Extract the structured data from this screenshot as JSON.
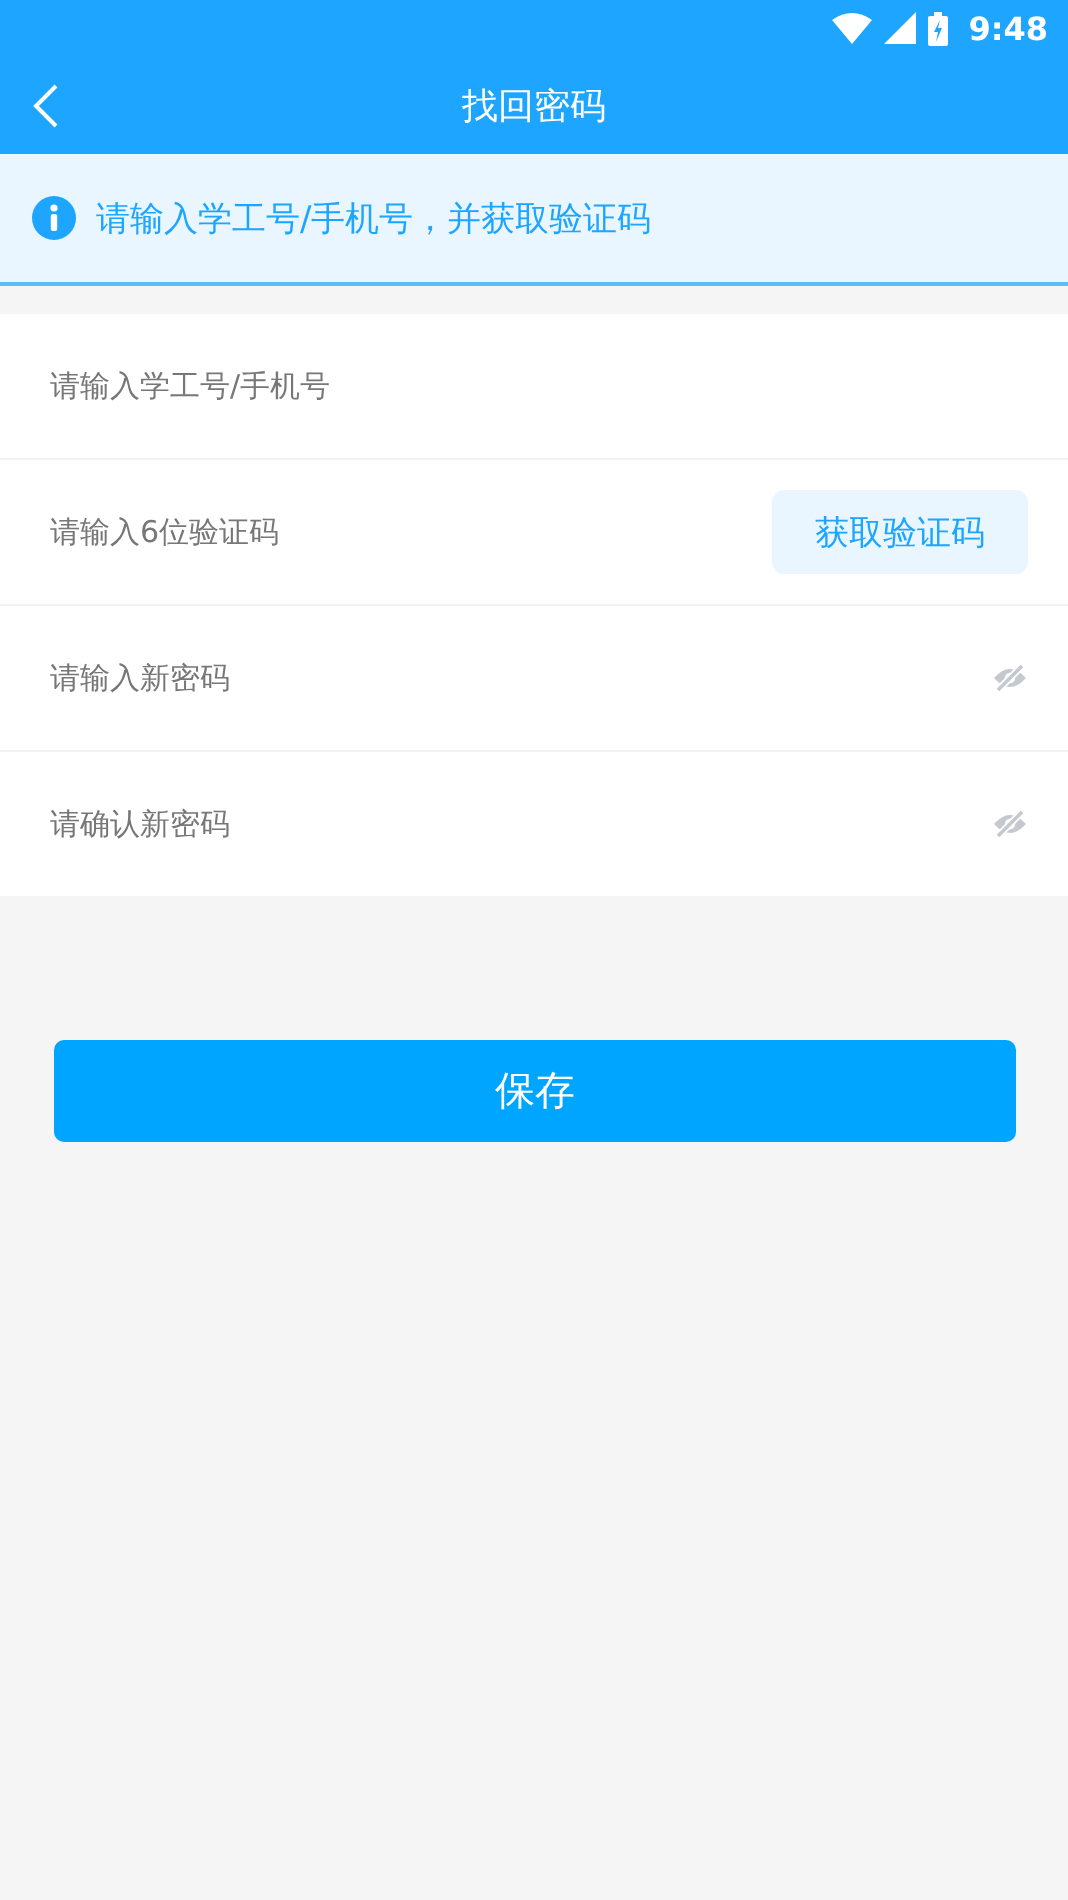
{
  "status_bar": {
    "time": "9:48"
  },
  "header": {
    "title": "找回密码"
  },
  "notice": {
    "text": "请输入学工号/手机号，并获取验证码"
  },
  "fields": [
    {
      "kind": "text",
      "placeholder": "请输入学工号/手机号"
    },
    {
      "kind": "code",
      "placeholder": "请输入6位验证码",
      "button": "获取验证码"
    },
    {
      "kind": "password",
      "placeholder": "请输入新密码",
      "visible": false
    },
    {
      "kind": "password",
      "placeholder": "请确认新密码",
      "visible": false
    }
  ],
  "save_button": "保存"
}
